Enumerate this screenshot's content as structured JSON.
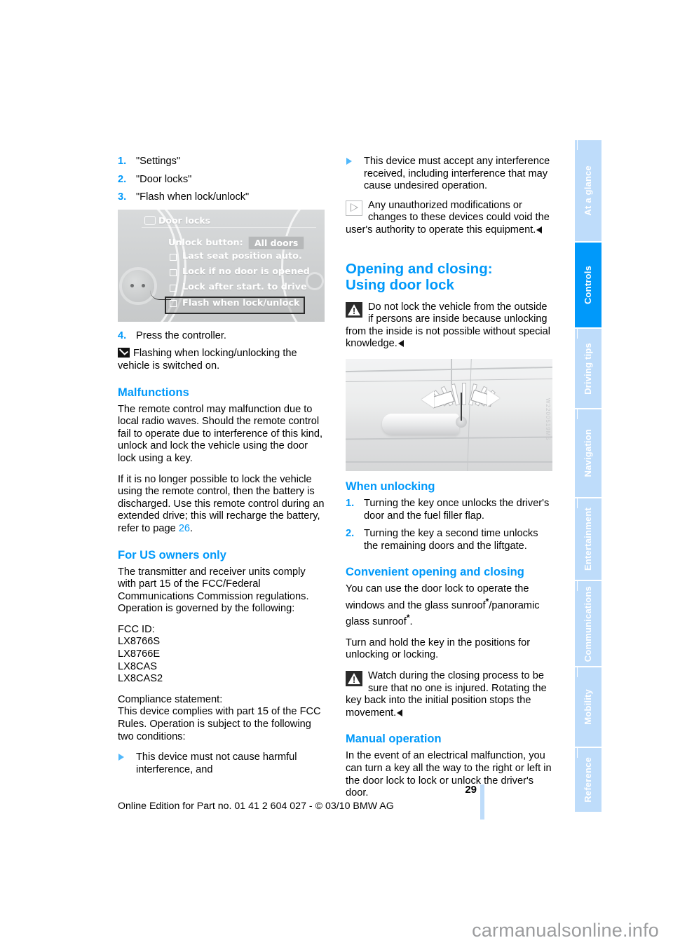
{
  "document": {
    "page_number": "29",
    "footer_note": "Online Edition for Part no. 01 41 2 604 027 - © 03/10 BMW AG",
    "watermark": "carmanualsonline.info"
  },
  "tab_rail": {
    "items": [
      {
        "label": "At a glance",
        "active": false
      },
      {
        "label": "Controls",
        "active": true
      },
      {
        "label": "Driving tips",
        "active": false
      },
      {
        "label": "Navigation",
        "active": false
      },
      {
        "label": "Entertainment",
        "active": false
      },
      {
        "label": "Communications",
        "active": false
      },
      {
        "label": "Mobility",
        "active": false
      },
      {
        "label": "Reference",
        "active": false
      }
    ],
    "active_color": "#0099fa",
    "inactive_color": "#bedcfa"
  },
  "left_column": {
    "steps_top": [
      {
        "num": "1.",
        "text": "\"Settings\""
      },
      {
        "num": "2.",
        "text": "\"Door locks\""
      },
      {
        "num": "3.",
        "text": "\"Flash when lock/unlock\""
      }
    ],
    "idrive_figure": {
      "title": "Door locks",
      "rows": [
        {
          "type": "chip-row",
          "label": "Unlock button:",
          "value": "All doors"
        },
        {
          "type": "checkbox",
          "label": "Last seat position auto.",
          "checked": false,
          "highlighted": false
        },
        {
          "type": "checkbox",
          "label": "Lock if no door is opened",
          "checked": false,
          "highlighted": false
        },
        {
          "type": "checkbox",
          "label": "Lock after start. to drive",
          "checked": false,
          "highlighted": false
        },
        {
          "type": "checkbox",
          "label": "Flash when lock/unlock",
          "checked": false,
          "highlighted": true
        }
      ]
    },
    "step_four": {
      "num": "4.",
      "text": "Press the controller."
    },
    "check_note": "Flashing when locking/unlocking the vehicle is switched on.",
    "malfunctions": {
      "heading": "Malfunctions",
      "paragraphs": [
        "The remote control may malfunction due to local radio waves. Should the remote control fail to operate due to interference of this kind, unlock and lock the vehicle using the door lock using a key.",
        "If it is no longer possible to lock the vehicle using the remote control, then the battery is discharged. Use this remote control during an extended drive; this will recharge the battery, refer to page "
      ],
      "page_ref": "26",
      "page_ref_suffix": "."
    },
    "us_owners": {
      "heading": "For US owners only",
      "intro": "The transmitter and receiver units comply with part 15 of the FCC/Federal Communications Commission regulations. Operation is governed by the following:",
      "fcc_id_label": "FCC ID:",
      "fcc_ids": [
        "LX8766S",
        "LX8766E",
        "LX8CAS",
        "LX8CAS2"
      ],
      "compliance_label": "Compliance statement:",
      "compliance_text": "This device complies with part 15 of the FCC Rules. Operation is subject to the following two conditions:",
      "condition_1": "This device must not cause harmful interference, and"
    }
  },
  "right_column": {
    "condition_2": "This device must accept any interference received, including interference that may cause undesired operation.",
    "unauthorized_note": {
      "text": "Any unauthorized modifications or changes to these devices could void the user's authority to operate this equipment.",
      "icon": "triangle-outline-icon"
    },
    "section_heading": {
      "line1": "Opening and closing:",
      "line2": "Using door lock"
    },
    "warning_note": {
      "text": "Do not lock the vehicle from the outside if persons are inside because unlocking from the inside is not possible without special knowledge.",
      "icon": "warning-triangle-icon"
    },
    "doorlock_figure": {
      "watermark": "W2200519MS"
    },
    "when_unlocking": {
      "heading": "When unlocking",
      "steps": [
        {
          "num": "1.",
          "text": "Turning the key once unlocks the driver's door and the fuel filler flap."
        },
        {
          "num": "2.",
          "text": "Turning the key a second time unlocks the remaining doors and the liftgate."
        }
      ]
    },
    "convenient": {
      "heading": "Convenient opening and closing",
      "para1_a": "You can use the door lock to operate the windows and the glass sunroof",
      "para1_star1": "*",
      "para1_b": "/panoramic glass sunroof",
      "para1_star2": "*",
      "para1_c": ".",
      "para2": "Turn and hold the key in the positions for unlocking or locking.",
      "warning_text": "Watch during the closing process to be sure that no one is injured. Rotating the key back into the initial position stops the movement."
    },
    "manual_operation": {
      "heading": "Manual operation",
      "text": "In the event of an electrical malfunction, you can turn a key all the way to the right or left in the door lock to lock or unlock the driver's door."
    }
  }
}
